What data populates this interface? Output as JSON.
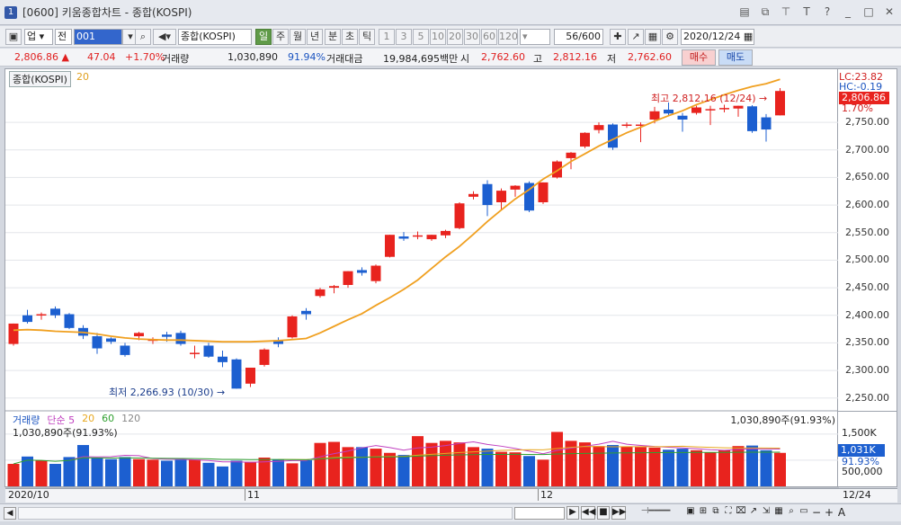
{
  "window": {
    "icon": "1",
    "title": "[0600] 키움종합차트 - 종합(KOSPI)"
  },
  "toolbar": {
    "market": "업",
    "all": "전",
    "code": "001",
    "name": "종합(KOSPI)",
    "periods": [
      "일",
      "주",
      "월",
      "년",
      "분",
      "초",
      "틱"
    ],
    "period_active": "일",
    "minutes": [
      "1",
      "3",
      "5",
      "10",
      "20",
      "30",
      "60",
      "120"
    ],
    "count": "56",
    "count_total": "/600",
    "date": "2020/12/24"
  },
  "info": {
    "price": "2,806.86",
    "change": "47.04",
    "change_pct": "+1.70%",
    "vol_label": "거래량",
    "vol": "1,030,890",
    "vol_pct": "91.94%",
    "amt_label": "거래대금",
    "amt": "19,984,695백만",
    "open_label": "시",
    "open": "2,762.60",
    "high_label": "고",
    "high": "2,812.16",
    "low_label": "저",
    "low": "2,762.60",
    "buy": "매수",
    "sell": "매도"
  },
  "chart": {
    "legend_name": "종합(KOSPI)",
    "legend_ma": "20",
    "lc": "LC:23.82",
    "hc": "HC:-0.19",
    "last_price_tag": "2,806.86",
    "last_pct_tag": "1.70%",
    "high_annot": "최고 2,812.16 (12/24)",
    "low_annot": "최저 2,266.93 (10/30)",
    "price_ticks": [
      "2,750.00",
      "2,700.00",
      "2,650.00",
      "2,600.00",
      "2,550.00",
      "2,500.00",
      "2,450.00",
      "2,400.00",
      "2,350.00",
      "2,300.00",
      "2,250.00"
    ],
    "volume_legend": {
      "name": "거래량",
      "ma_label": "단순",
      "mas": [
        "5",
        "20",
        "60",
        "120"
      ]
    },
    "volume_value_line": "1,030,890주(91.93%)",
    "volume_value_right": "1,030,890주(91.93%)",
    "volume_ticks": [
      "1,500K",
      "500,000"
    ],
    "volume_tag": "1,031K",
    "volume_pct_tag": "91.93%",
    "x_labels": [
      "2020/10",
      "11",
      "12"
    ],
    "x_right_label": "12/24",
    "colors": {
      "up": "#e8231e",
      "down": "#1c5fd0",
      "ma20": "#f0a020",
      "vol_ma5": "#c040c0",
      "vol_ma20": "#e8a820",
      "vol_ma60": "#30a030"
    }
  },
  "chart_data": {
    "type": "candlestick",
    "y_range": [
      2230,
      2830
    ],
    "candles": [
      {
        "o": 2348,
        "h": 2385,
        "l": 2345,
        "c": 2385
      },
      {
        "o": 2400,
        "h": 2410,
        "l": 2385,
        "c": 2388
      },
      {
        "o": 2400,
        "h": 2405,
        "l": 2392,
        "c": 2402
      },
      {
        "o": 2412,
        "h": 2416,
        "l": 2395,
        "c": 2400
      },
      {
        "o": 2402,
        "h": 2404,
        "l": 2375,
        "c": 2377
      },
      {
        "o": 2377,
        "h": 2382,
        "l": 2357,
        "c": 2363
      },
      {
        "o": 2362,
        "h": 2368,
        "l": 2330,
        "c": 2340
      },
      {
        "o": 2358,
        "h": 2360,
        "l": 2348,
        "c": 2352
      },
      {
        "o": 2345,
        "h": 2350,
        "l": 2325,
        "c": 2328
      },
      {
        "o": 2362,
        "h": 2370,
        "l": 2355,
        "c": 2368
      },
      {
        "o": 2356,
        "h": 2360,
        "l": 2348,
        "c": 2356
      },
      {
        "o": 2365,
        "h": 2370,
        "l": 2352,
        "c": 2361
      },
      {
        "o": 2368,
        "h": 2372,
        "l": 2345,
        "c": 2348
      },
      {
        "o": 2330,
        "h": 2345,
        "l": 2322,
        "c": 2332
      },
      {
        "o": 2345,
        "h": 2350,
        "l": 2323,
        "c": 2325
      },
      {
        "o": 2325,
        "h": 2336,
        "l": 2306,
        "c": 2315
      },
      {
        "o": 2320,
        "h": 2322,
        "l": 2266.93,
        "c": 2267
      },
      {
        "o": 2276,
        "h": 2305,
        "l": 2270,
        "c": 2305
      },
      {
        "o": 2310,
        "h": 2340,
        "l": 2307,
        "c": 2338
      },
      {
        "o": 2355,
        "h": 2360,
        "l": 2342,
        "c": 2348
      },
      {
        "o": 2360,
        "h": 2400,
        "l": 2358,
        "c": 2398
      },
      {
        "o": 2408,
        "h": 2413,
        "l": 2392,
        "c": 2402
      },
      {
        "o": 2435,
        "h": 2450,
        "l": 2432,
        "c": 2447
      },
      {
        "o": 2450,
        "h": 2455,
        "l": 2440,
        "c": 2453
      },
      {
        "o": 2455,
        "h": 2480,
        "l": 2450,
        "c": 2480
      },
      {
        "o": 2482,
        "h": 2487,
        "l": 2472,
        "c": 2477
      },
      {
        "o": 2462,
        "h": 2492,
        "l": 2458,
        "c": 2490
      },
      {
        "o": 2506,
        "h": 2546,
        "l": 2505,
        "c": 2546
      },
      {
        "o": 2543,
        "h": 2551,
        "l": 2535,
        "c": 2539
      },
      {
        "o": 2545,
        "h": 2552,
        "l": 2538,
        "c": 2545
      },
      {
        "o": 2538,
        "h": 2546,
        "l": 2535,
        "c": 2546
      },
      {
        "o": 2545,
        "h": 2555,
        "l": 2540,
        "c": 2553
      },
      {
        "o": 2558,
        "h": 2605,
        "l": 2556,
        "c": 2603
      },
      {
        "o": 2615,
        "h": 2625,
        "l": 2610,
        "c": 2620
      },
      {
        "o": 2638,
        "h": 2645,
        "l": 2580,
        "c": 2600
      },
      {
        "o": 2605,
        "h": 2630,
        "l": 2592,
        "c": 2626
      },
      {
        "o": 2628,
        "h": 2636,
        "l": 2615,
        "c": 2635
      },
      {
        "o": 2640,
        "h": 2643,
        "l": 2587,
        "c": 2590
      },
      {
        "o": 2605,
        "h": 2641,
        "l": 2602,
        "c": 2641
      },
      {
        "o": 2650,
        "h": 2681,
        "l": 2648,
        "c": 2679
      },
      {
        "o": 2685,
        "h": 2696,
        "l": 2665,
        "c": 2695
      },
      {
        "o": 2706,
        "h": 2732,
        "l": 2703,
        "c": 2731
      },
      {
        "o": 2736,
        "h": 2750,
        "l": 2730,
        "c": 2745
      },
      {
        "o": 2746,
        "h": 2748,
        "l": 2700,
        "c": 2704
      },
      {
        "o": 2745,
        "h": 2750,
        "l": 2740,
        "c": 2746
      },
      {
        "o": 2745,
        "h": 2750,
        "l": 2714,
        "c": 2746
      },
      {
        "o": 2755,
        "h": 2778,
        "l": 2748,
        "c": 2770
      },
      {
        "o": 2773,
        "h": 2786,
        "l": 2763,
        "c": 2766
      },
      {
        "o": 2762,
        "h": 2767,
        "l": 2733,
        "c": 2755
      },
      {
        "o": 2767,
        "h": 2780,
        "l": 2764,
        "c": 2777
      },
      {
        "o": 2772,
        "h": 2780,
        "l": 2745,
        "c": 2774
      },
      {
        "o": 2774,
        "h": 2782,
        "l": 2768,
        "c": 2776
      },
      {
        "o": 2775,
        "h": 2780,
        "l": 2760,
        "c": 2780
      },
      {
        "o": 2779,
        "h": 2781,
        "l": 2731,
        "c": 2734
      },
      {
        "o": 2759,
        "h": 2765,
        "l": 2715,
        "c": 2737
      },
      {
        "o": 2762.6,
        "h": 2812.16,
        "l": 2762.6,
        "c": 2806.86
      }
    ],
    "ma20": [
      2373,
      2374,
      2373,
      2371,
      2370,
      2369,
      2366,
      2362,
      2359,
      2357,
      2356,
      2355,
      2355,
      2354,
      2353,
      2352,
      2352,
      2352,
      2353,
      2354,
      2356,
      2358,
      2368,
      2380,
      2392,
      2403,
      2418,
      2432,
      2447,
      2464,
      2485,
      2506,
      2525,
      2547,
      2570,
      2591,
      2611,
      2628,
      2647,
      2662,
      2679,
      2693,
      2707,
      2719,
      2731,
      2741,
      2752,
      2762,
      2771,
      2782,
      2791,
      2800,
      2808,
      2815,
      2820,
      2828
    ],
    "volume": [
      430,
      570,
      490,
      430,
      560,
      790,
      540,
      520,
      560,
      520,
      510,
      490,
      510,
      510,
      450,
      380,
      490,
      470,
      550,
      510,
      440,
      500,
      830,
      850,
      750,
      750,
      720,
      640,
      600,
      960,
      830,
      870,
      840,
      750,
      720,
      660,
      650,
      580,
      510,
      1040,
      870,
      840,
      770,
      790,
      760,
      750,
      740,
      700,
      720,
      690,
      650,
      690,
      770,
      780,
      690,
      640
    ],
    "volume_range": [
      0,
      1100
    ]
  }
}
